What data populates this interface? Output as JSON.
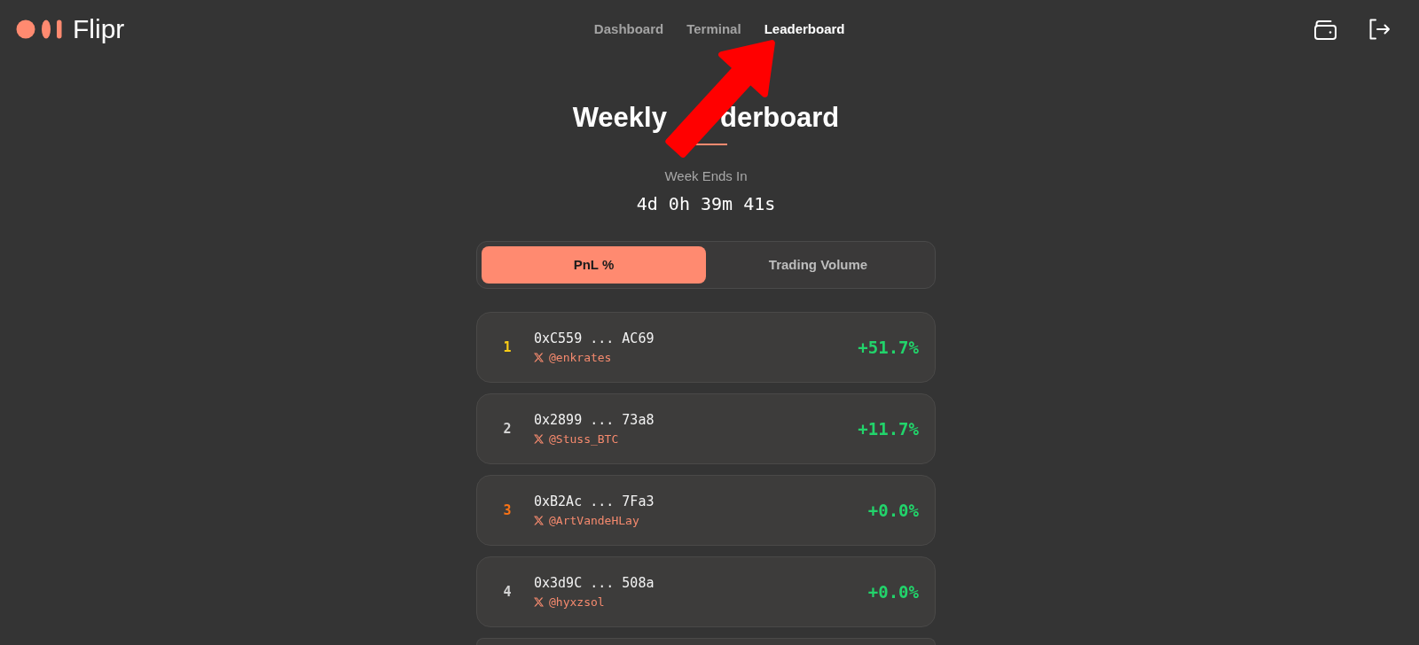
{
  "header": {
    "app_name": "Flipr",
    "nav": [
      {
        "label": "Dashboard",
        "selected": false
      },
      {
        "label": "Terminal",
        "selected": false
      },
      {
        "label": "Leaderboard",
        "selected": true
      }
    ]
  },
  "title_visible_parts": [
    "Weekly",
    "derboard"
  ],
  "countdown": {
    "label": "Week Ends In",
    "value": "4d 0h 39m 41s"
  },
  "tabs": [
    {
      "label": "PnL %",
      "selected": true
    },
    {
      "label": "Trading Volume",
      "selected": false
    }
  ],
  "rows": [
    {
      "kind": "entry",
      "rank": "1",
      "color": "#facc15",
      "address": "0xC559 ... AC69",
      "handle": "@enkrates",
      "pnl": "+51.7%"
    },
    {
      "kind": "entry",
      "rank": "2",
      "color": "#d4d4d4",
      "address": "0x2899 ... 73a8",
      "handle": "@Stuss_BTC",
      "pnl": "+11.7%"
    },
    {
      "kind": "entry",
      "rank": "3",
      "color": "#f97316",
      "address": "0xB2Ac ... 7Fa3",
      "handle": "@ArtVandeHLay",
      "pnl": "+0.0%"
    },
    {
      "kind": "entry",
      "rank": "4",
      "color": "#d4d4d4",
      "address": "0x3d9C ... 508a",
      "handle": "@hyxzsol",
      "pnl": "+0.0%"
    },
    {
      "kind": "cut_off"
    }
  ]
}
